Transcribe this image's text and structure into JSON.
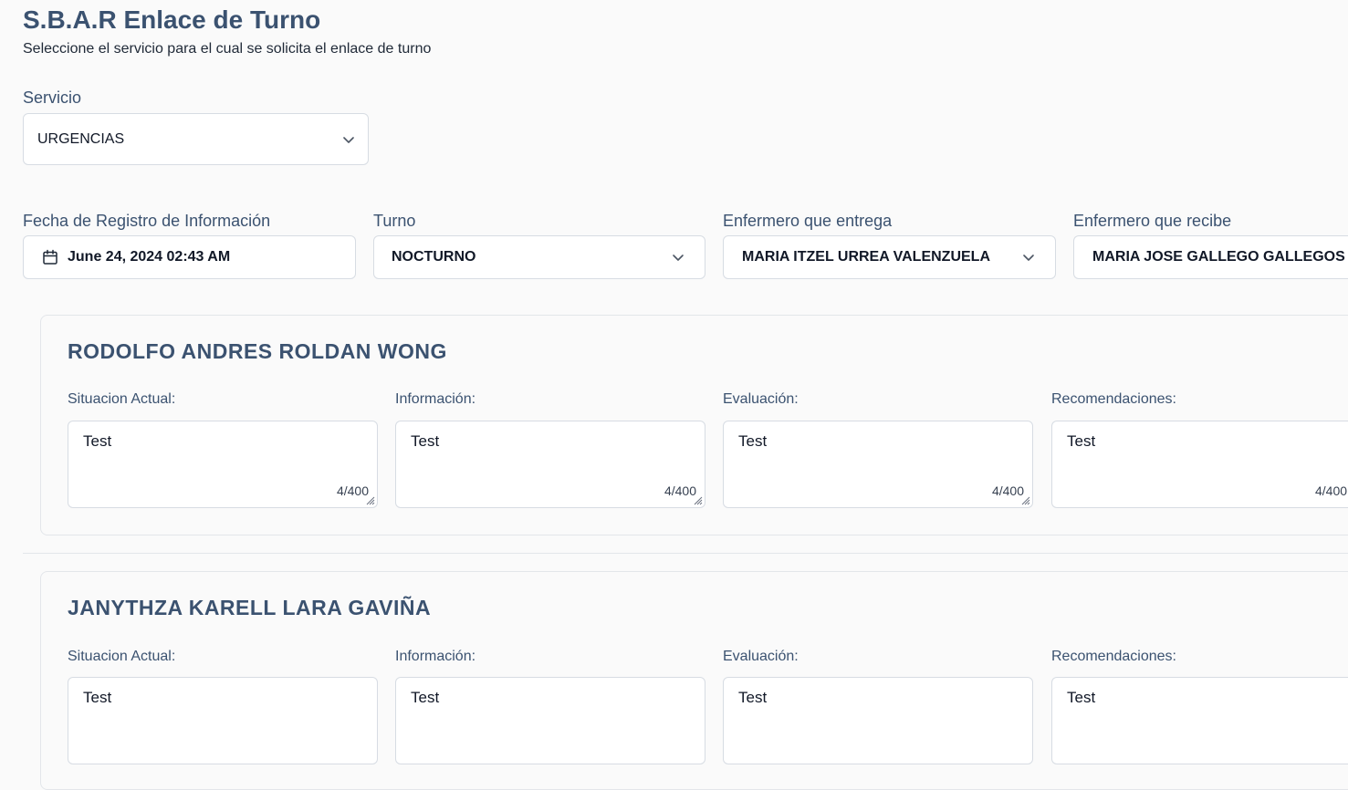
{
  "header": {
    "title": "S.B.A.R Enlace de Turno",
    "subtitle": "Seleccione el servicio para el cual se solicita el enlace de turno"
  },
  "servicio": {
    "label": "Servicio",
    "value": "URGENCIAS",
    "icon": "chevron-down-icon"
  },
  "registro": {
    "fecha_label": "Fecha de Registro de Información",
    "fecha_value": "June 24, 2024 02:43 AM",
    "fecha_icon": "calendar-icon",
    "turno_label": "Turno",
    "turno_value": "NOCTURNO",
    "entrega_label": "Enfermero que entrega",
    "entrega_value": "MARIA ITZEL URREA VALENZUELA",
    "recibe_label": "Enfermero que recibe",
    "recibe_value": "MARIA JOSE GALLEGO GALLEGOS"
  },
  "patients": [
    {
      "name": "RODOLFO ANDRES ROLDAN WONG",
      "fields": [
        {
          "label": "Situacion Actual:",
          "value": "Test",
          "count": "4/400"
        },
        {
          "label": "Información:",
          "value": "Test",
          "count": "4/400"
        },
        {
          "label": "Evaluación:",
          "value": "Test",
          "count": "4/400"
        },
        {
          "label": "Recomendaciones:",
          "value": "Test",
          "count": "4/400"
        }
      ]
    },
    {
      "name": "JANYTHZA KARELL LARA GAVIÑA",
      "fields": [
        {
          "label": "Situacion Actual:",
          "value": "Test"
        },
        {
          "label": "Información:",
          "value": "Test"
        },
        {
          "label": "Evaluación:",
          "value": "Test"
        },
        {
          "label": "Recomendaciones:",
          "value": "Test"
        }
      ]
    }
  ],
  "colors": {
    "heading": "#3b5270",
    "border": "#d7dce3",
    "background": "#fafafa"
  }
}
